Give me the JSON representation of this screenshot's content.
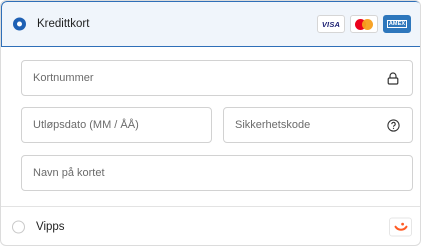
{
  "card_option": {
    "label": "Kredittkort",
    "selected": true,
    "brand_icons": [
      "visa-logo",
      "mastercard-logo",
      "amex-logo"
    ],
    "visa_text": "VISA",
    "amex_text": "AMEX"
  },
  "fields": {
    "card_number": {
      "placeholder": "Kortnummer",
      "icon": "lock-icon"
    },
    "expiry": {
      "placeholder": "Utløpsdato (MM / ÅÅ)"
    },
    "security_code": {
      "placeholder": "Sikkerhetskode",
      "icon": "help-circle-icon"
    },
    "name_on_card": {
      "placeholder": "Navn på kortet"
    }
  },
  "vipps_option": {
    "label": "Vipps",
    "selected": false,
    "icon": "vipps-logo"
  },
  "colors": {
    "accent": "#1f61b4",
    "selected_bg": "#f0f5fb",
    "vipps_orange": "#ff5b24"
  }
}
